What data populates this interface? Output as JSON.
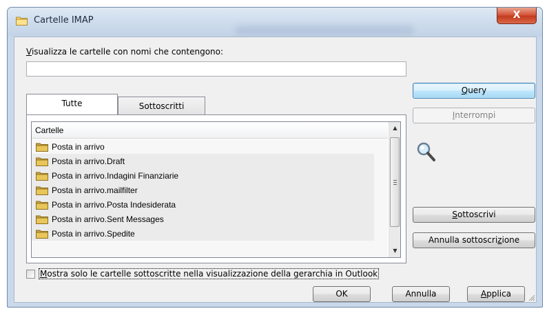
{
  "window": {
    "title": "Cartelle IMAP",
    "close_glyph": "X",
    "title_icon": "folder-icon"
  },
  "filter": {
    "label_prefix": "",
    "label_hotkey": "V",
    "label_rest": "isualizza le cartelle con nomi che contengono:",
    "value": "",
    "placeholder": ""
  },
  "buttons": {
    "query": {
      "hotkey": "Q",
      "rest": "uery"
    },
    "stop": {
      "hotkey": "I",
      "rest": "nterrompi"
    },
    "subscribe": {
      "hotkey": "S",
      "rest": "ottoscrivi"
    },
    "unsubscribe": {
      "pre": "Annulla sottoscri",
      "hotkey": "z",
      "rest": "ione"
    },
    "ok": "OK",
    "cancel": "Annulla",
    "apply": {
      "hotkey": "A",
      "rest": "pplica"
    }
  },
  "tabs": [
    {
      "label": "Tutte",
      "active": true
    },
    {
      "label": "Sottoscritti",
      "active": false
    }
  ],
  "list": {
    "header": "Cartelle",
    "items": [
      "Posta in arrivo",
      "Posta in arrivo.Draft",
      "Posta in arrivo.Indagini Finanziarie",
      "Posta in arrivo.mailfilter",
      "Posta in arrivo.Posta Indesiderata",
      "Posta in arrivo.Sent Messages",
      "Posta in arrivo.Spedite"
    ],
    "scroll_up_glyph": "▲",
    "scroll_down_glyph": "▼"
  },
  "option": {
    "checked": false,
    "hotkey": "M",
    "rest": "ostra solo le cartelle sottoscritte nella visualizzazione della gerarchia in Outlook"
  },
  "icons": {
    "search": "magnifier-icon",
    "folder": "folder-icon"
  },
  "colors": {
    "folder": "#e8c65a",
    "default_button_border": "#3c7fb1",
    "close_button": "#c23b1f"
  }
}
